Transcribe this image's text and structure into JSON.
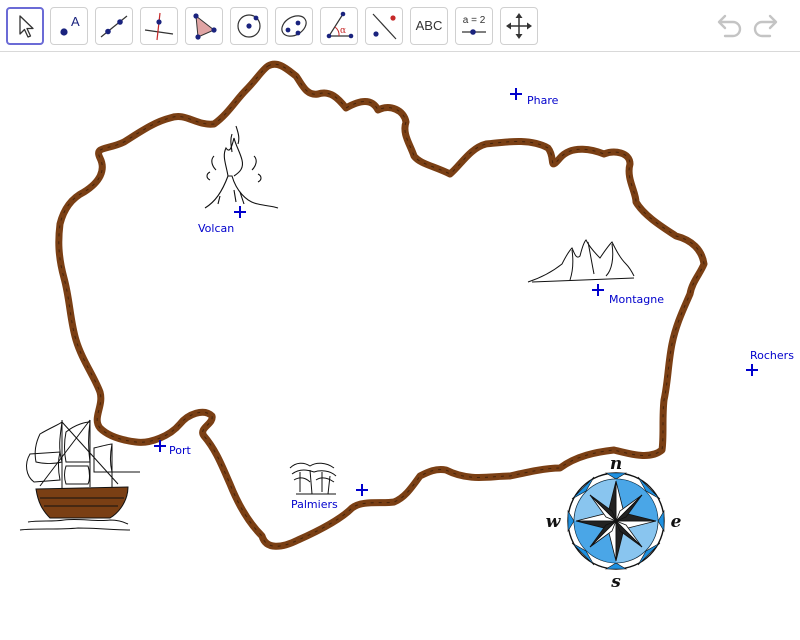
{
  "toolbar": {
    "tools": [
      {
        "name": "move-tool",
        "icon": "arrow-cursor-icon",
        "selected": true
      },
      {
        "name": "point-tool",
        "icon": "point-label-icon",
        "label": "A"
      },
      {
        "name": "line-tool",
        "icon": "line-through-points-icon"
      },
      {
        "name": "perpendicular-tool",
        "icon": "perpendicular-line-icon"
      },
      {
        "name": "polygon-tool",
        "icon": "polygon-icon"
      },
      {
        "name": "circle-tool",
        "icon": "circle-center-point-icon"
      },
      {
        "name": "conic-tool",
        "icon": "ellipse-icon"
      },
      {
        "name": "angle-tool",
        "icon": "angle-icon",
        "label": "α"
      },
      {
        "name": "reflect-tool",
        "icon": "reflect-about-line-icon"
      },
      {
        "name": "text-tool",
        "icon": "text-icon",
        "label": "ABC"
      },
      {
        "name": "slider-tool",
        "icon": "slider-icon",
        "label": "a = 2"
      },
      {
        "name": "move-graphics-tool",
        "icon": "move-arrows-icon"
      }
    ],
    "undo_icon": "undo-icon",
    "redo_icon": "redo-icon"
  },
  "points": [
    {
      "name": "Phare",
      "label": "Phare"
    },
    {
      "name": "Volcan",
      "label": "Volcan"
    },
    {
      "name": "Montagne",
      "label": "Montagne"
    },
    {
      "name": "Rochers",
      "label": "Rochers"
    },
    {
      "name": "Port",
      "label": "Port"
    },
    {
      "name": "Palmiers",
      "label": "Palmiers"
    }
  ],
  "compass": {
    "north": "n",
    "east": "e",
    "south": "s",
    "west": "w"
  },
  "colors": {
    "coast": "#7a3f14",
    "point": "#0000cc",
    "compass_blue": "#1e90e0"
  }
}
